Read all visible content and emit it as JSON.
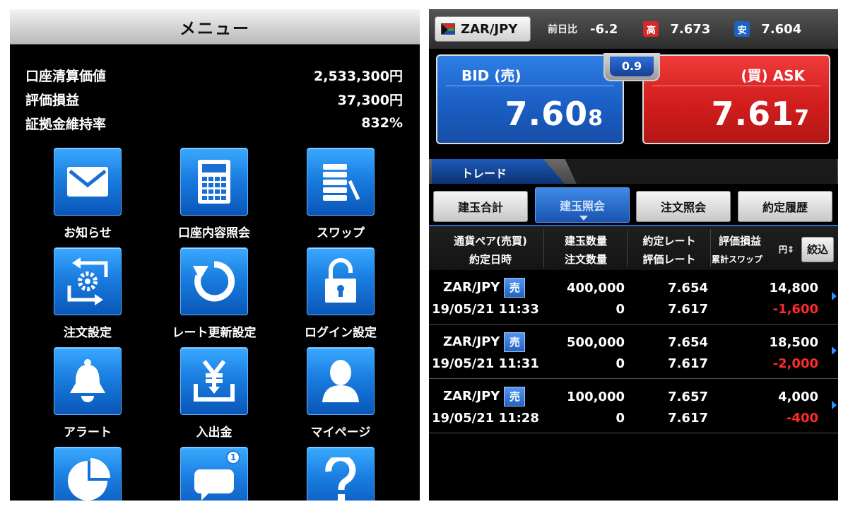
{
  "menu": {
    "title": "メニュー",
    "account": [
      {
        "label": "口座清算価値",
        "value": "2,533,300円"
      },
      {
        "label": "評価損益",
        "value": "37,300円"
      },
      {
        "label": "証拠金維持率",
        "value": "832%"
      }
    ],
    "items": [
      {
        "label": "お知らせ",
        "icon": "envelope-icon"
      },
      {
        "label": "口座内容照会",
        "icon": "calculator-icon"
      },
      {
        "label": "スワップ",
        "icon": "coins-icon"
      },
      {
        "label": "注文設定",
        "icon": "gear-cycle-icon"
      },
      {
        "label": "レート更新設定",
        "icon": "refresh-icon"
      },
      {
        "label": "ログイン設定",
        "icon": "padlock-icon"
      },
      {
        "label": "アラート",
        "icon": "bell-icon"
      },
      {
        "label": "入出金",
        "icon": "yen-tray-icon"
      },
      {
        "label": "マイページ",
        "icon": "person-icon"
      },
      {
        "label": "",
        "icon": "pie-chart-icon"
      },
      {
        "label": "",
        "icon": "message-icon",
        "badge": "1"
      },
      {
        "label": "",
        "icon": "question-icon"
      }
    ]
  },
  "trade": {
    "pair": "ZAR/JPY",
    "change_label": "前日比",
    "change": "-6.2",
    "high_badge": "高",
    "high": "7.673",
    "low_badge": "安",
    "low": "7.604",
    "bid": {
      "title": "BID (売)",
      "price_main": "7.60",
      "price_pip": "8"
    },
    "ask": {
      "title": "(買) ASK",
      "price_main": "7.61",
      "price_pip": "7"
    },
    "spread": "0.9",
    "section": "トレード",
    "tabs": [
      "建玉合計",
      "建玉照会",
      "注文照会",
      "約定履歴"
    ],
    "active_tab": 1,
    "headers": {
      "c1a": "通貨ペア(売買)",
      "c1b": "約定日時",
      "c2a": "建玉数量",
      "c2b": "注文数量",
      "c3a": "約定レート",
      "c3b": "評価レート",
      "c4a": "評価損益",
      "c4b": "累計スワップ",
      "unit": "円",
      "filter": "絞込"
    },
    "rows": [
      {
        "pair": "ZAR/JPY",
        "side": "売",
        "datetime": "19/05/21 11:33",
        "qty": "400,000",
        "order_qty": "0",
        "rate": "7.654",
        "eval_rate": "7.617",
        "pnl": "14,800",
        "swap": "-1,600"
      },
      {
        "pair": "ZAR/JPY",
        "side": "売",
        "datetime": "19/05/21 11:31",
        "qty": "500,000",
        "order_qty": "0",
        "rate": "7.654",
        "eval_rate": "7.617",
        "pnl": "18,500",
        "swap": "-2,000"
      },
      {
        "pair": "ZAR/JPY",
        "side": "売",
        "datetime": "19/05/21 11:28",
        "qty": "100,000",
        "order_qty": "0",
        "rate": "7.657",
        "eval_rate": "7.617",
        "pnl": "4,000",
        "swap": "-400"
      }
    ],
    "colors": {
      "bid": "#1b5fc6",
      "ask": "#d21d1d",
      "negative": "#ff2a2a",
      "accent": "#2b6bd0"
    }
  }
}
